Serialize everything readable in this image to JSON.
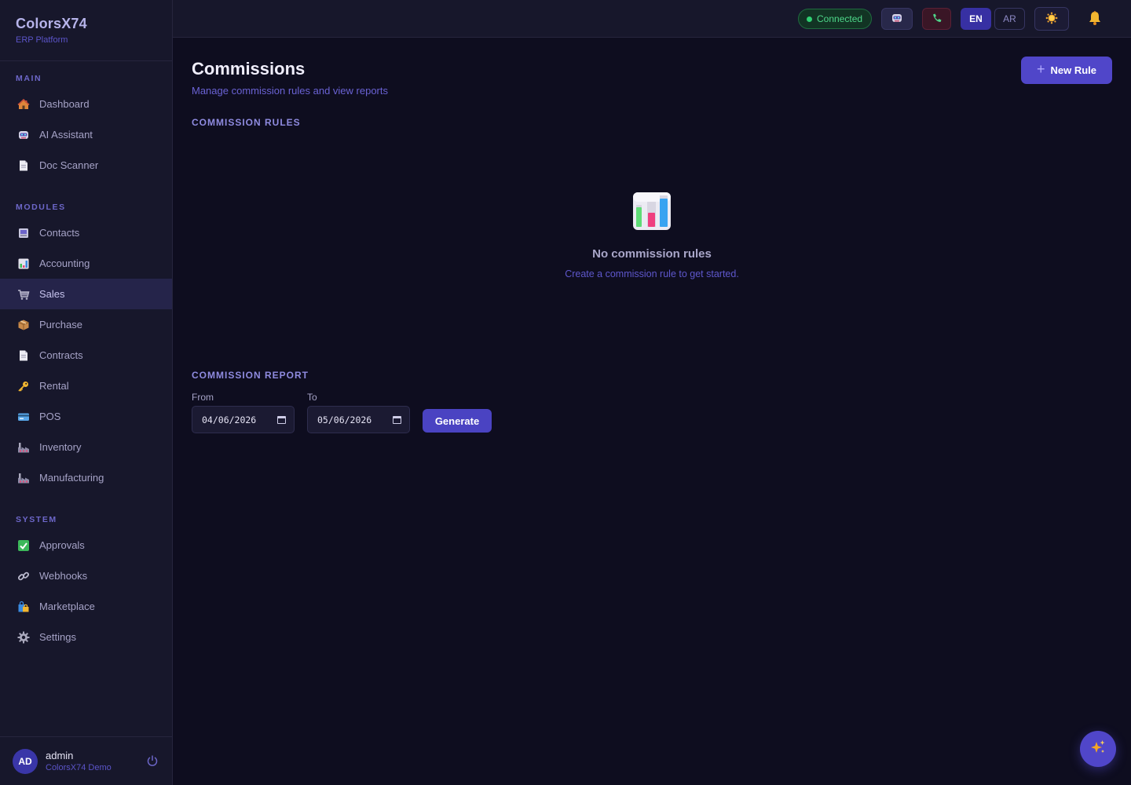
{
  "brand": {
    "title": "ColorsX74",
    "subtitle": "ERP Platform"
  },
  "sidebar": {
    "sections": [
      {
        "label": "MAIN",
        "items": [
          {
            "label": "Dashboard",
            "icon": "house-icon"
          },
          {
            "label": "AI Assistant",
            "icon": "robot-icon"
          },
          {
            "label": "Doc Scanner",
            "icon": "document-icon"
          }
        ]
      },
      {
        "label": "MODULES",
        "items": [
          {
            "label": "Contacts",
            "icon": "contacts-icon"
          },
          {
            "label": "Accounting",
            "icon": "bar-chart-icon"
          },
          {
            "label": "Sales",
            "icon": "cart-icon",
            "active": true
          },
          {
            "label": "Purchase",
            "icon": "package-icon"
          },
          {
            "label": "Contracts",
            "icon": "document-icon"
          },
          {
            "label": "Rental",
            "icon": "key-icon"
          },
          {
            "label": "POS",
            "icon": "credit-card-icon"
          },
          {
            "label": "Inventory",
            "icon": "factory-icon"
          },
          {
            "label": "Manufacturing",
            "icon": "factory-icon"
          }
        ]
      },
      {
        "label": "SYSTEM",
        "items": [
          {
            "label": "Approvals",
            "icon": "check-box-icon"
          },
          {
            "label": "Webhooks",
            "icon": "link-icon"
          },
          {
            "label": "Marketplace",
            "icon": "shopping-bags-icon"
          },
          {
            "label": "Settings",
            "icon": "gear-icon"
          }
        ]
      }
    ]
  },
  "user": {
    "initials": "AD",
    "name": "admin",
    "org": "ColorsX74 Demo"
  },
  "topbar": {
    "status": "Connected",
    "lang_en": "EN",
    "lang_ar": "AR"
  },
  "page": {
    "title": "Commissions",
    "subtitle": "Manage commission rules and view reports",
    "new_rule_label": "New Rule",
    "rules_heading": "COMMISSION RULES",
    "empty_title": "No commission rules",
    "empty_subtitle": "Create a commission rule to get started.",
    "report_heading": "COMMISSION REPORT",
    "from_label": "From",
    "from_value": "04/06/2026",
    "to_label": "To",
    "to_value": "05/06/2026",
    "generate_label": "Generate"
  },
  "colors": {
    "accent": "#5046c9",
    "background": "#0e0d1f",
    "sidebar": "#17172b",
    "status_green": "#2fd173"
  }
}
